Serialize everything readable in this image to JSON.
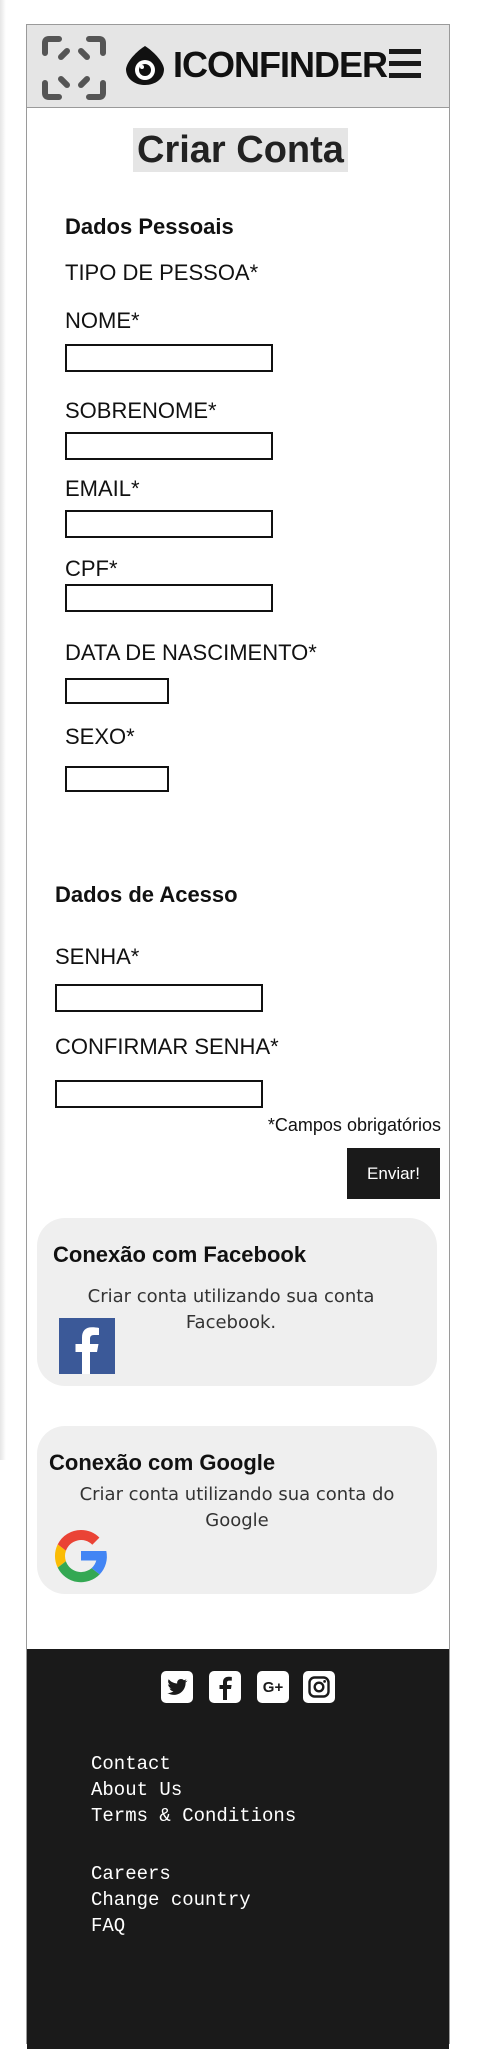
{
  "header": {
    "brand": "ICONFINDER",
    "scan_icon": "scan-frame-icon",
    "logo_icon": "eye-logo-icon",
    "menu_icon": "hamburger-icon"
  },
  "form": {
    "title": "Criar Conta",
    "personal_section": "Dados Pessoais",
    "person_type_label": "TIPO DE PESSOA*",
    "first_name_label": "NOME*",
    "last_name_label": "SOBRENOME*",
    "email_label": "EMAIL*",
    "cpf_label": "CPF*",
    "birthdate_label": "DATA DE NASCIMENTO*",
    "gender_label": "SEXO*",
    "access_section": "Dados de Acesso",
    "password_label": "SENHA*",
    "confirm_password_label": "CONFIRMAR SENHA*",
    "required_note": "*Campos obrigatórios",
    "submit_label": "Enviar!"
  },
  "facebook": {
    "title": "Conexão com Facebook",
    "text": "Criar conta utilizando sua conta Facebook.",
    "icon": "facebook-icon",
    "color": "#3b5998"
  },
  "google": {
    "title": "Conexão com Google",
    "text": "Criar conta utilizando sua conta do Google",
    "icon": "google-icon"
  },
  "footer": {
    "social_icons": [
      "twitter-icon",
      "facebook-icon",
      "google-plus-icon",
      "instagram-icon"
    ],
    "google_plus_glyph": "G+",
    "links_group1": [
      "Contact",
      "About Us",
      "Terms & Conditions"
    ],
    "links_group2": [
      "Careers",
      "Change country",
      "FAQ"
    ]
  },
  "colors": {
    "header_bg": "#e5e5e5",
    "footer_bg": "#1a1a1a",
    "card_bg": "#efefef",
    "button_bg": "#1a1a1a"
  }
}
